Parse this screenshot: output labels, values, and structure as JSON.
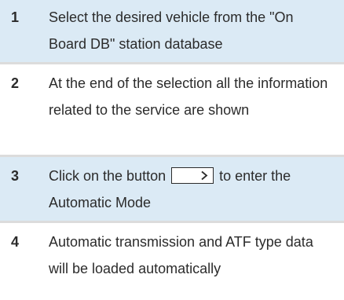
{
  "steps": [
    {
      "number": "1",
      "text": "Select the desired vehicle from the \"On Board DB\" station database"
    },
    {
      "number": "2",
      "text": "At the end of the selection all the information related to the service are shown"
    },
    {
      "number": "3",
      "text_before": "Click on the button",
      "text_after": "to enter the Automatic Mode",
      "button_icon": "chevron-right-icon"
    },
    {
      "number": "4",
      "text": "Automatic transmission and ATF type data will be loaded automatically"
    }
  ],
  "colors": {
    "shaded_row": "#dbeaf5",
    "divider": "#dcdcdc",
    "text": "#2b2b2b"
  }
}
